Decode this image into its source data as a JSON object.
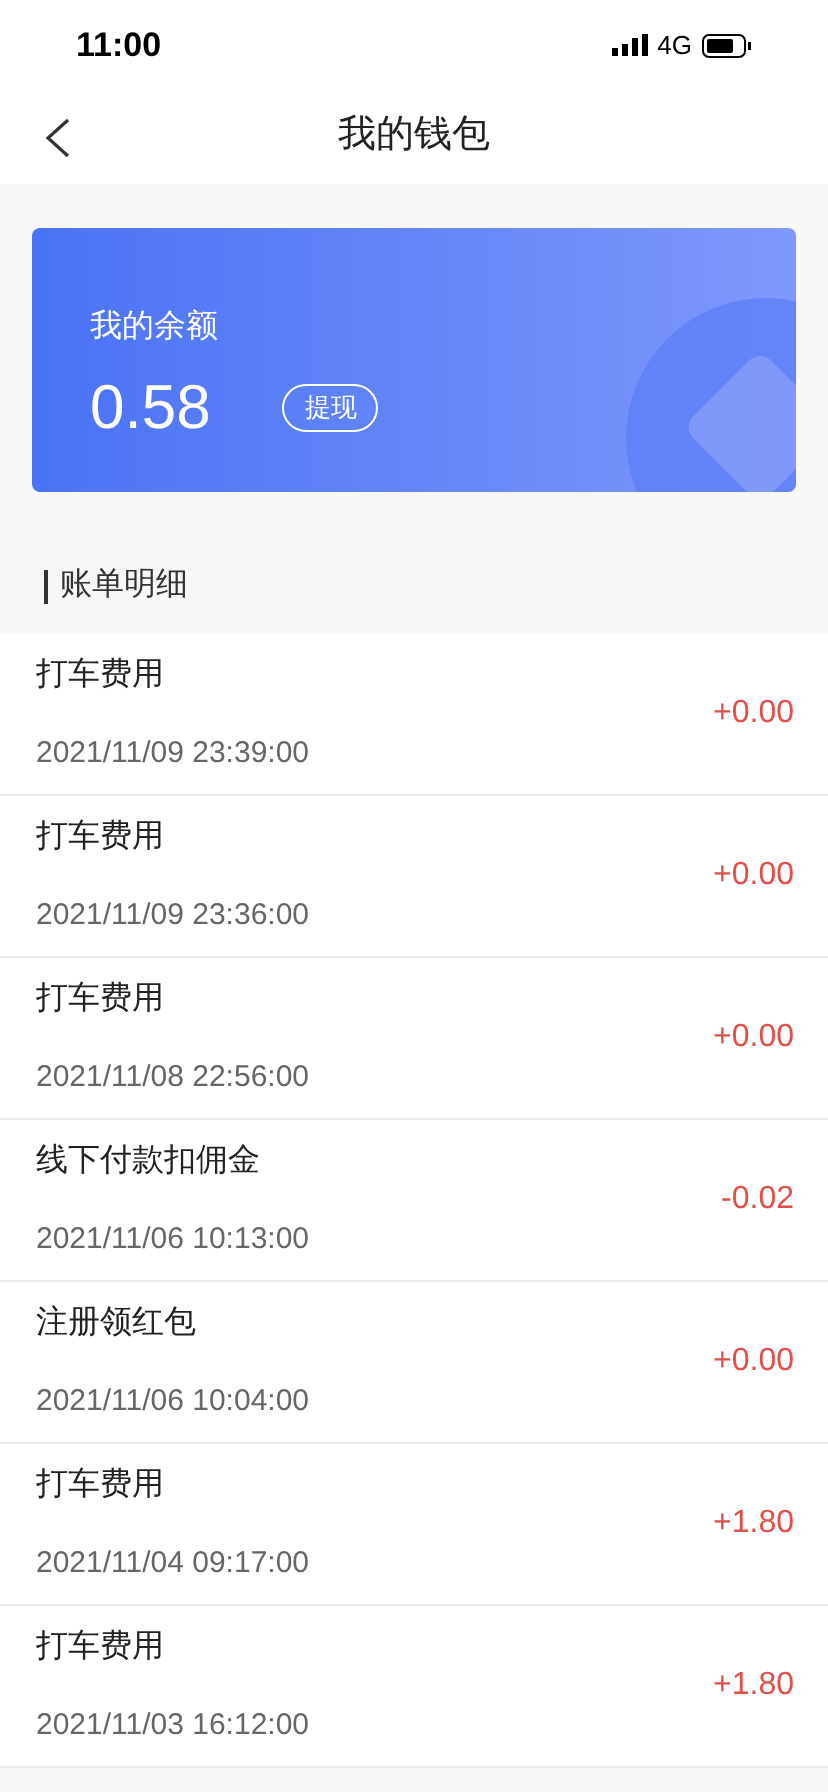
{
  "status_bar": {
    "time": "11:00",
    "network": "4G"
  },
  "header": {
    "title": "我的钱包"
  },
  "balance_card": {
    "label": "我的余额",
    "amount": "0.58",
    "withdraw_button": "提现"
  },
  "section_title": "账单明细",
  "transactions": [
    {
      "title": "打车费用",
      "time": "2021/11/09 23:39:00",
      "amount": "+0.00"
    },
    {
      "title": "打车费用",
      "time": "2021/11/09 23:36:00",
      "amount": "+0.00"
    },
    {
      "title": "打车费用",
      "time": "2021/11/08 22:56:00",
      "amount": "+0.00"
    },
    {
      "title": "线下付款扣佣金",
      "time": "2021/11/06 10:13:00",
      "amount": "-0.02"
    },
    {
      "title": "注册领红包",
      "time": "2021/11/06 10:04:00",
      "amount": "+0.00"
    },
    {
      "title": "打车费用",
      "time": "2021/11/04 09:17:00",
      "amount": "+1.80"
    },
    {
      "title": "打车费用",
      "time": "2021/11/03 16:12:00",
      "amount": "+1.80"
    }
  ]
}
